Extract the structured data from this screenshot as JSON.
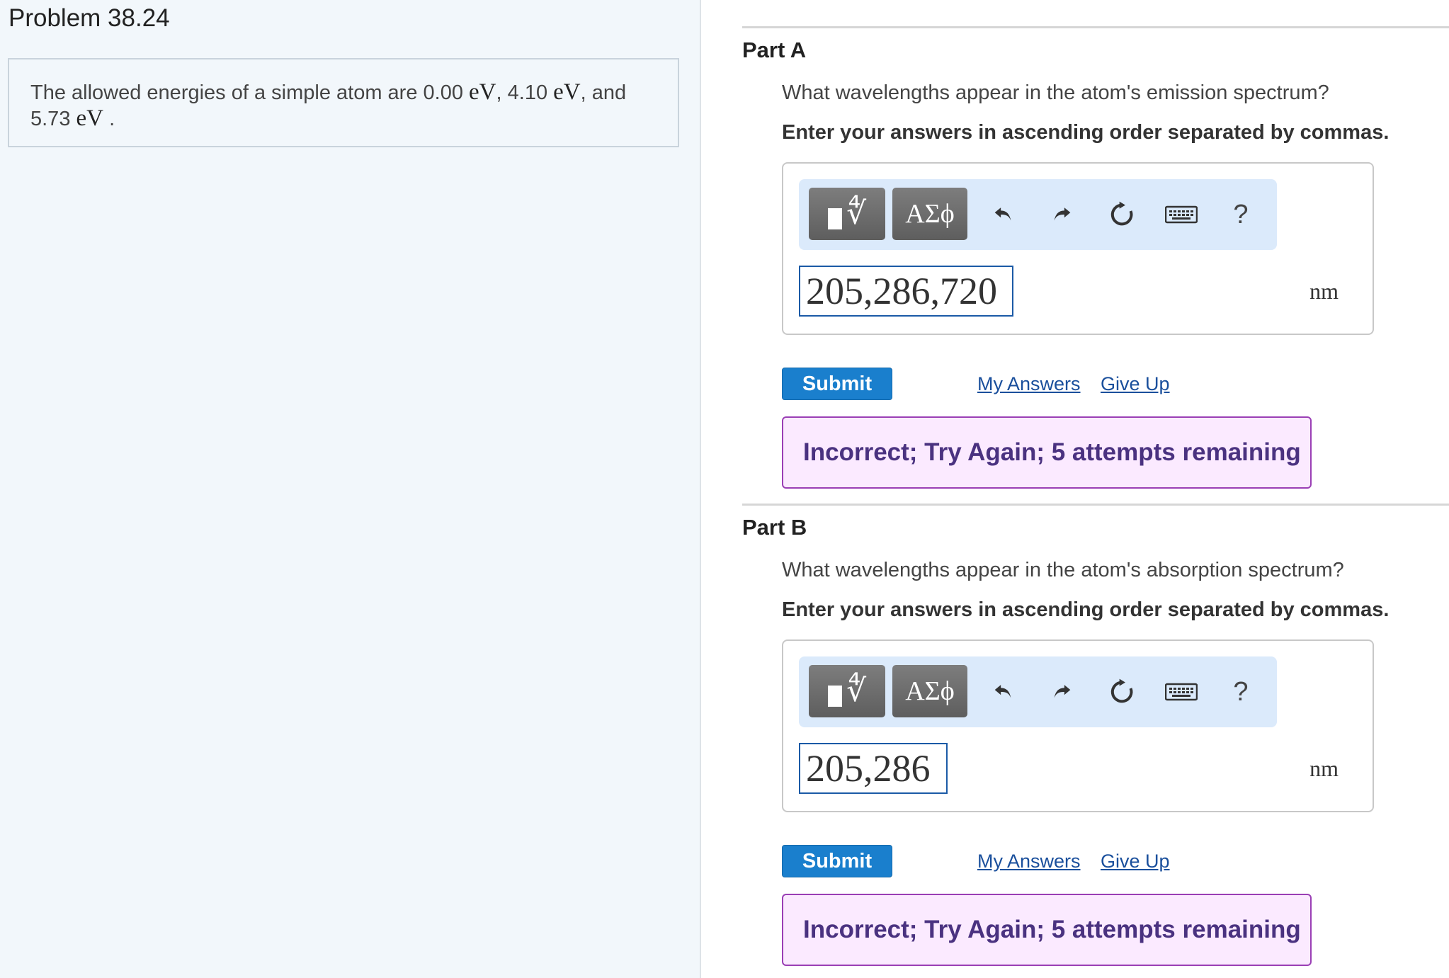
{
  "problem": {
    "title": "Problem 38.24",
    "text_part1": "The allowed energies of a simple atom are 0.00",
    "unit_ev": "eV",
    "text_part2": ", 4.10",
    "text_part3": ", and",
    "text_part4": "5.73",
    "text_end": "."
  },
  "parts": [
    {
      "title": "Part A",
      "question": "What wavelengths appear in the atom's emission spectrum?",
      "instruction": "Enter your answers in ascending order separated by commas.",
      "toolbar": {
        "template_icon": "templates-icon",
        "greek_label": "ΑΣϕ",
        "undo_icon": "undo-icon",
        "redo_icon": "redo-icon",
        "reset_icon": "reset-icon",
        "keyboard_icon": "keyboard-icon",
        "help_label": "?"
      },
      "answer_value": "205,286,720",
      "unit": "nm",
      "submit_label": "Submit",
      "my_answers_label": "My Answers",
      "give_up_label": "Give Up",
      "feedback": "Incorrect; Try Again; 5 attempts remaining"
    },
    {
      "title": "Part B",
      "question": "What wavelengths appear in the atom's absorption spectrum?",
      "instruction": "Enter your answers in ascending order separated by commas.",
      "toolbar": {
        "template_icon": "templates-icon",
        "greek_label": "ΑΣϕ",
        "undo_icon": "undo-icon",
        "redo_icon": "redo-icon",
        "reset_icon": "reset-icon",
        "keyboard_icon": "keyboard-icon",
        "help_label": "?"
      },
      "answer_value": "205,286",
      "unit": "nm",
      "submit_label": "Submit",
      "my_answers_label": "My Answers",
      "give_up_label": "Give Up",
      "feedback": "Incorrect; Try Again; 5 attempts remaining"
    }
  ],
  "colors": {
    "left_pane_bg": "#f2f7fb",
    "toolbar_bg": "#dbeafb",
    "submit_bg": "#1a7fcd",
    "feedback_bg": "#fbeaff",
    "feedback_border": "#9a3fb5",
    "link": "#1a4f9c"
  }
}
